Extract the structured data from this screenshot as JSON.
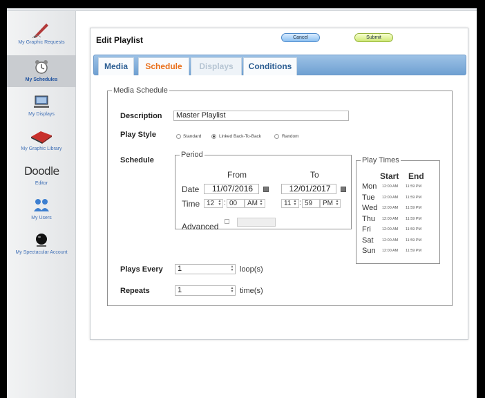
{
  "sidebar": {
    "items": [
      {
        "label": "My Graphic Requests",
        "icon": "pen-icon"
      },
      {
        "label": "My Schedules",
        "icon": "alarm-clock-icon",
        "active": true
      },
      {
        "label": "My Displays",
        "icon": "display-icon"
      },
      {
        "label": "My Graphic Library",
        "icon": "book-icon"
      },
      {
        "label": "Editor",
        "icon": "doodle-logo",
        "logo": "Doodle"
      },
      {
        "label": "My Users",
        "icon": "users-icon"
      },
      {
        "label": "My Spectacular Account",
        "icon": "account-ball-icon"
      }
    ]
  },
  "header": {
    "title": "Edit Playlist",
    "cancel_label": "Cancel",
    "submit_label": "Submit"
  },
  "tabs": [
    {
      "label": "Media"
    },
    {
      "label": "Schedule",
      "active": true
    },
    {
      "label": "Displays",
      "disabled": true
    },
    {
      "label": "Conditions"
    }
  ],
  "form": {
    "legend": "Media Schedule",
    "description_label": "Description",
    "description_value": "Master Playlist",
    "play_style_label": "Play Style",
    "play_style_options": [
      {
        "label": "Standard",
        "selected": false
      },
      {
        "label": "Linked Back-To-Back",
        "selected": true
      },
      {
        "label": "Random",
        "selected": false
      }
    ],
    "schedule_label": "Schedule",
    "period": {
      "legend": "Period",
      "from_label": "From",
      "to_label": "To",
      "date_label": "Date",
      "from_date": "11/07/2016",
      "to_date": "12/01/2017",
      "time_label": "Time",
      "from_hour": "12",
      "from_minute": "00",
      "from_ampm": "AM",
      "to_hour": "11",
      "to_minute": "59",
      "to_ampm": "PM",
      "advanced_label": "Advanced"
    },
    "play_times": {
      "legend": "Play Times",
      "start_label": "Start",
      "end_label": "End",
      "rows": [
        {
          "day": "Mon",
          "start": "12:00 AM",
          "end": "11:59 PM"
        },
        {
          "day": "Tue",
          "start": "12:00 AM",
          "end": "11:59 PM"
        },
        {
          "day": "Wed",
          "start": "12:00 AM",
          "end": "11:59 PM"
        },
        {
          "day": "Thu",
          "start": "12:00 AM",
          "end": "11:59 PM"
        },
        {
          "day": "Fri",
          "start": "12:00 AM",
          "end": "11:59 PM"
        },
        {
          "day": "Sat",
          "start": "12:00 AM",
          "end": "11:59 PM"
        },
        {
          "day": "Sun",
          "start": "12:00 AM",
          "end": "11:59 PM"
        }
      ]
    },
    "plays_every_label": "Plays Every",
    "plays_every_value": "1",
    "plays_every_unit": "loop(s)",
    "repeats_label": "Repeats",
    "repeats_value": "1",
    "repeats_unit": "time(s)"
  }
}
